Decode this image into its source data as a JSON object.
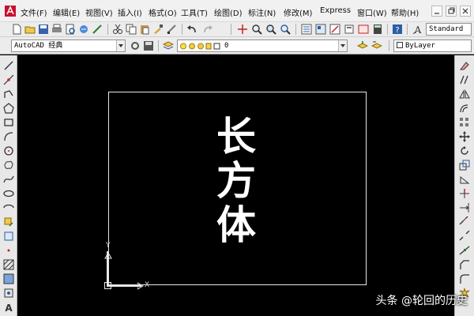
{
  "menu": {
    "items": [
      "文件(F)",
      "编辑(E)",
      "视图(V)",
      "插入(I)",
      "格式(O)",
      "工具(T)",
      "绘图(D)",
      "标注(N)",
      "修改(M)",
      "Express",
      "窗口(W)",
      "帮助(H)"
    ]
  },
  "toolbar": {
    "text_style": "Standard",
    "workspace": "AutoCAD 经典",
    "layer": "0",
    "color": "ByLayer"
  },
  "drawing": {
    "text_lines": [
      "长",
      "方",
      "体"
    ],
    "ucs_x": "X",
    "ucs_y": "Y"
  },
  "watermark": "头条 @轮回的历史",
  "colors": {
    "canvas_bg": "#000000",
    "drawing_lines": "#ffffff",
    "ui_bg": "#ececec"
  }
}
